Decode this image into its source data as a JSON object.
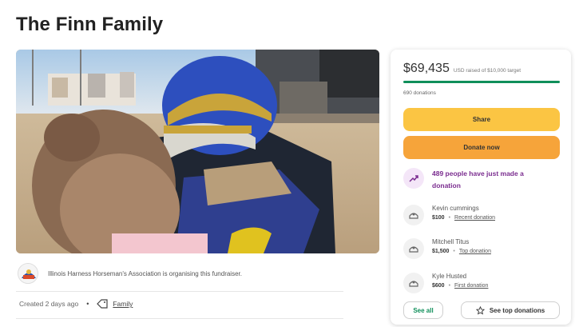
{
  "page": {
    "title": "The Finn Family"
  },
  "hero": {
    "image": "fundraiser-photo-harness-driver-with-child"
  },
  "organiser": {
    "avatar": "association-logo",
    "text": "Illinois Harness Horseman's Association is organising this fundraiser."
  },
  "meta": {
    "created": "Created 2 days ago",
    "separator": "•",
    "category_icon": "tag-icon",
    "category": "Family"
  },
  "card": {
    "raised": "$69,435",
    "target": "USD raised of $10,000 target",
    "progress_fraction": 1.0,
    "progress_color": "#0f8f5a",
    "donations": "690 donations",
    "share_label": "Share",
    "donate_label": "Donate now",
    "share_color": "#fbc543",
    "donate_color": "#f6a43a",
    "momentum_icon": "trending-up-icon",
    "momentum_text": "489 people have just made a donation",
    "donors": [
      {
        "name": "Kevin cummings",
        "amount": "$100",
        "separator": "•",
        "kind": "Recent donation",
        "icon": "donor-hands-icon"
      },
      {
        "name": "Mitchell Titus",
        "amount": "$1,500",
        "separator": "•",
        "kind": "Top donation",
        "icon": "donor-hands-icon"
      },
      {
        "name": "Kyle Husted",
        "amount": "$600",
        "separator": "•",
        "kind": "First donation",
        "icon": "donor-hands-icon"
      }
    ],
    "see_all_label": "See all",
    "top_donations_label": "See top donations",
    "top_icon": "star-icon"
  }
}
